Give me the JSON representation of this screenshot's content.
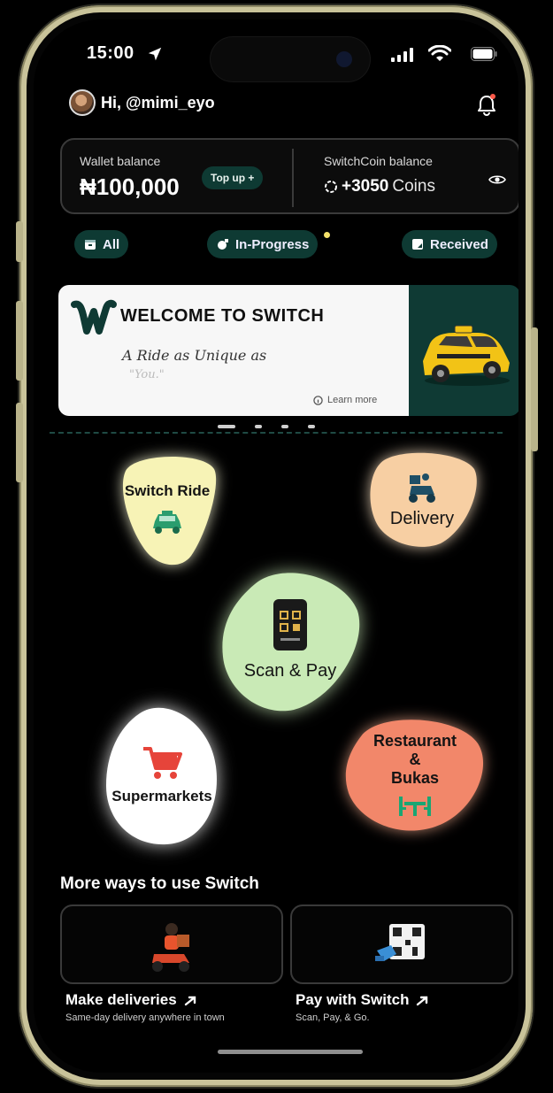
{
  "status_bar": {
    "time": "15:00"
  },
  "header": {
    "greeting": "Hi, @mimi_eyo"
  },
  "wallet": {
    "label": "Wallet balance",
    "amount": "₦100,000",
    "topup_label": "Top up +",
    "coin_label": "SwitchCoin balance",
    "coin_amount": "+3050",
    "coin_unit": "Coins"
  },
  "filters": [
    {
      "label": "All"
    },
    {
      "label": "In-Progress"
    },
    {
      "label": "Received"
    }
  ],
  "banner": {
    "title": "WELCOME TO SWITCH",
    "tagline": "A Ride as Unique as",
    "tagline_2": "\"You.\"",
    "learn_more": "Learn more"
  },
  "services": [
    {
      "label": "Switch Ride",
      "color": "#f7f3b6"
    },
    {
      "label": "Delivery",
      "color": "#f7cfa3"
    },
    {
      "label": "Scan & Pay",
      "color": "#c9eab6"
    },
    {
      "label": "Supermarkets",
      "color": "#ffffff"
    },
    {
      "label_lines": [
        "Restaurant",
        "&",
        "Bukas"
      ],
      "color": "#f2876a"
    }
  ],
  "more_ways": {
    "title": "More ways to use Switch",
    "items": [
      {
        "title": "Make deliveries",
        "subtitle": "Same-day delivery anywhere in town"
      },
      {
        "title": "Pay with Switch",
        "subtitle": "Scan, Pay, & Go."
      }
    ]
  },
  "colors": {
    "accent": "#0e3a33",
    "banner_right": "#0f3a34",
    "background": "#000000"
  }
}
